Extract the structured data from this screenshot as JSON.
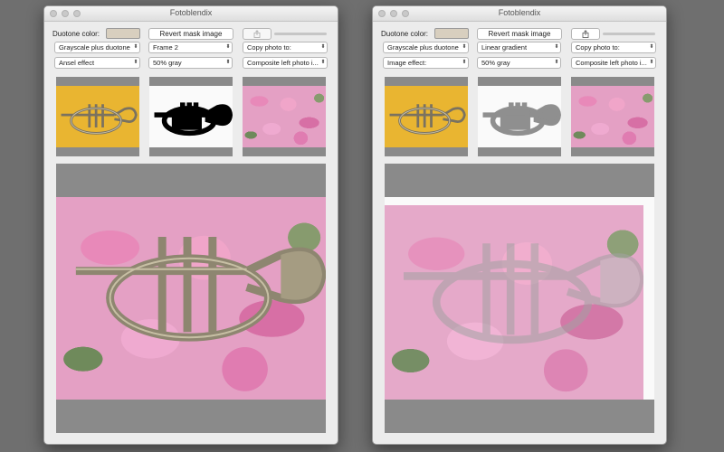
{
  "windows": [
    {
      "title": "Fotoblendix",
      "duotone_label": "Duotone color:",
      "duotone_color": "#d8cfbf",
      "revert_label": "Revert mask image",
      "mode_popup": "Grayscale plus duotone",
      "frame_popup": "Frame 2",
      "copy_popup": "Copy photo to:",
      "effect_popup": "Ansel effect",
      "gray_popup": "50% gray",
      "composite_popup": "Composite left photo i...",
      "mask_style": "silhouette"
    },
    {
      "title": "Fotoblendix",
      "duotone_label": "Duotone color:",
      "duotone_color": "#d8cfbf",
      "revert_label": "Revert mask image",
      "mode_popup": "Grayscale plus duotone",
      "frame_popup": "Linear gradient",
      "copy_popup": "Copy photo to:",
      "effect_popup": "Image effect:",
      "gray_popup": "50% gray",
      "composite_popup": "Composite left photo i...",
      "mask_style": "gray"
    }
  ],
  "colors": {
    "desktop": "#6f6f6f",
    "window_bg": "#ececec",
    "well_gray": "#8a8a8a",
    "trumpet_brass": "#a59c82",
    "photo_bg_yellow": "#e9b531"
  },
  "icons": {
    "share": "share-icon",
    "popup_arrows": "up-down-arrows-icon"
  }
}
